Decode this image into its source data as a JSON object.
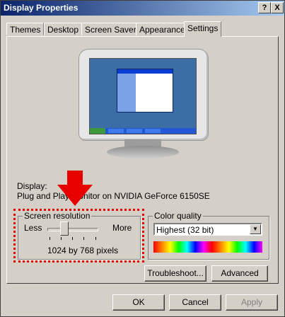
{
  "window": {
    "title": "Display Properties",
    "help_button": "?",
    "close_button": "X"
  },
  "tabs": [
    {
      "label": "Themes"
    },
    {
      "label": "Desktop"
    },
    {
      "label": "Screen Saver"
    },
    {
      "label": "Appearance"
    },
    {
      "label": "Settings",
      "active": true
    }
  ],
  "display": {
    "label": "Display:",
    "device": "Plug and Play Monitor on NVIDIA GeForce 6150SE"
  },
  "screen_resolution": {
    "group_label": "Screen resolution",
    "less_label": "Less",
    "more_label": "More",
    "value": "1024 by 768 pixels"
  },
  "color_quality": {
    "group_label": "Color quality",
    "selected": "Highest (32 bit)"
  },
  "buttons": {
    "troubleshoot": "Troubleshoot...",
    "advanced": "Advanced",
    "ok": "OK",
    "cancel": "Cancel",
    "apply": "Apply"
  },
  "colors": {
    "title_bar": "#0a246a",
    "highlight": "#e60000",
    "arrow": "#e60000",
    "face": "#d4d0c8"
  }
}
